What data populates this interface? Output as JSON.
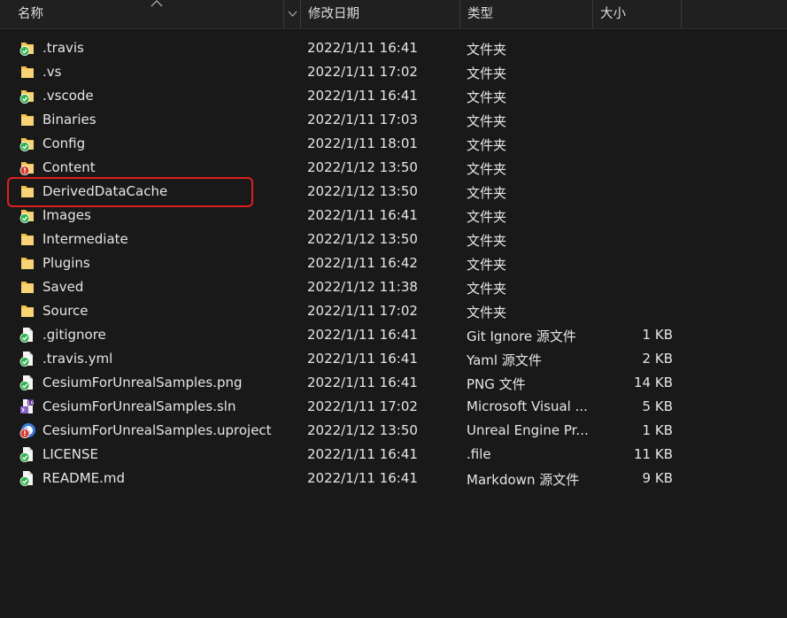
{
  "columns": {
    "name": "名称",
    "date": "修改日期",
    "type": "类型",
    "size": "大小"
  },
  "rows": [
    {
      "name": ".travis",
      "date": "2022/1/11 16:41",
      "type": "文件夹",
      "size": "",
      "icon": "folder-check-icon"
    },
    {
      "name": ".vs",
      "date": "2022/1/11 17:02",
      "type": "文件夹",
      "size": "",
      "icon": "folder-icon"
    },
    {
      "name": ".vscode",
      "date": "2022/1/11 16:41",
      "type": "文件夹",
      "size": "",
      "icon": "folder-check-icon"
    },
    {
      "name": "Binaries",
      "date": "2022/1/11 17:03",
      "type": "文件夹",
      "size": "",
      "icon": "folder-icon"
    },
    {
      "name": "Config",
      "date": "2022/1/11 18:01",
      "type": "文件夹",
      "size": "",
      "icon": "folder-check-icon"
    },
    {
      "name": "Content",
      "date": "2022/1/12 13:50",
      "type": "文件夹",
      "size": "",
      "icon": "folder-modified-icon"
    },
    {
      "name": "DerivedDataCache",
      "date": "2022/1/12 13:50",
      "type": "文件夹",
      "size": "",
      "icon": "folder-icon"
    },
    {
      "name": "Images",
      "date": "2022/1/11 16:41",
      "type": "文件夹",
      "size": "",
      "icon": "folder-check-icon"
    },
    {
      "name": "Intermediate",
      "date": "2022/1/12 13:50",
      "type": "文件夹",
      "size": "",
      "icon": "folder-icon"
    },
    {
      "name": "Plugins",
      "date": "2022/1/11 16:42",
      "type": "文件夹",
      "size": "",
      "icon": "folder-icon"
    },
    {
      "name": "Saved",
      "date": "2022/1/12 11:38",
      "type": "文件夹",
      "size": "",
      "icon": "folder-icon"
    },
    {
      "name": "Source",
      "date": "2022/1/11 17:02",
      "type": "文件夹",
      "size": "",
      "icon": "folder-icon"
    },
    {
      "name": ".gitignore",
      "date": "2022/1/11 16:41",
      "type": "Git Ignore 源文件",
      "size": "1 KB",
      "icon": "file-check-icon"
    },
    {
      "name": ".travis.yml",
      "date": "2022/1/11 16:41",
      "type": "Yaml 源文件",
      "size": "2 KB",
      "icon": "file-check-icon"
    },
    {
      "name": "CesiumForUnrealSamples.png",
      "date": "2022/1/11 16:41",
      "type": "PNG 文件",
      "size": "14 KB",
      "icon": "file-check-icon"
    },
    {
      "name": "CesiumForUnrealSamples.sln",
      "date": "2022/1/11 17:02",
      "type": "Microsoft Visual ...",
      "size": "5 KB",
      "icon": "visual-studio-sln-icon"
    },
    {
      "name": "CesiumForUnrealSamples.uproject",
      "date": "2022/1/12 13:50",
      "type": "Unreal Engine Pr...",
      "size": "1 KB",
      "icon": "unreal-project-modified-icon"
    },
    {
      "name": "LICENSE",
      "date": "2022/1/11 16:41",
      "type": ".file",
      "size": "11 KB",
      "icon": "file-check-icon"
    },
    {
      "name": "README.md",
      "date": "2022/1/11 16:41",
      "type": "Markdown 源文件",
      "size": "9 KB",
      "icon": "file-check-icon"
    }
  ],
  "highlighted_row": "DerivedDataCache",
  "colors": {
    "background": "#191919",
    "folder": "#f3c04a",
    "check": "#2bb54a",
    "modified": "#d83b2b",
    "highlight_border": "#e02020"
  }
}
